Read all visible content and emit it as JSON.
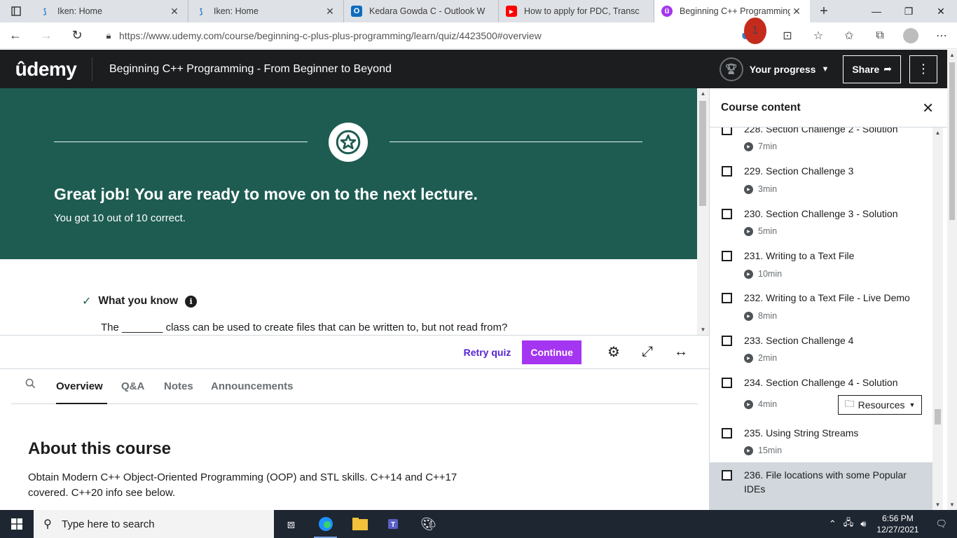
{
  "browser": {
    "tabs": [
      {
        "title": "Iken: Home",
        "favicon": "iken-icon",
        "active": false
      },
      {
        "title": "Iken: Home",
        "favicon": "iken-icon",
        "active": false
      },
      {
        "title": "Kedara Gowda C - Outlook W",
        "favicon": "outlook-icon",
        "active": false
      },
      {
        "title": "How to apply for PDC, Transc",
        "favicon": "youtube-icon",
        "active": false
      },
      {
        "title": "Beginning C++ Programming",
        "favicon": "udemy-icon",
        "active": true
      }
    ],
    "url": "https://www.udemy.com/course/beginning-c-plus-plus-programming/learn/quiz/4423500#overview",
    "notification_count": "1"
  },
  "header": {
    "logo": "ûdemy",
    "course_title": "Beginning C++ Programming - From Beginner to Beyond",
    "progress_label": "Your progress",
    "share_label": "Share"
  },
  "quiz": {
    "headline": "Great job! You are ready to move on to the next lecture.",
    "score_text": "You got 10 out of 10 correct.",
    "what_you_know": "What you know",
    "question": "The _______ class can be used to create files that can be written to, but not read from?",
    "retry_label": "Retry quiz",
    "continue_label": "Continue",
    "accent": "#a435f0",
    "banner_color": "#1e5c52"
  },
  "tabs": [
    "Overview",
    "Q&A",
    "Notes",
    "Announcements"
  ],
  "about": {
    "title": "About this course",
    "description": "Obtain Modern C++ Object-Oriented Programming (OOP) and STL skills. C++14 and C++17 covered. C++20 info see below."
  },
  "sidebar": {
    "title": "Course content",
    "items": [
      {
        "title": "228. Section Challenge 2 - Solution",
        "duration": "7min"
      },
      {
        "title": "229. Section Challenge 3",
        "duration": "3min"
      },
      {
        "title": "230. Section Challenge 3 - Solution",
        "duration": "5min"
      },
      {
        "title": "231. Writing to a Text File",
        "duration": "10min"
      },
      {
        "title": "232. Writing to a Text File - Live Demo",
        "duration": "8min"
      },
      {
        "title": "233. Section Challenge 4",
        "duration": "2min"
      },
      {
        "title": "234. Section Challenge 4 - Solution",
        "duration": "4min",
        "resources": "Resources"
      },
      {
        "title": "235. Using String Streams",
        "duration": "15min"
      },
      {
        "title": "236. File locations with some Popular IDEs",
        "duration": ""
      }
    ]
  },
  "taskbar": {
    "search_placeholder": "Type here to search",
    "time": "6:56 PM",
    "date": "12/27/2021"
  }
}
